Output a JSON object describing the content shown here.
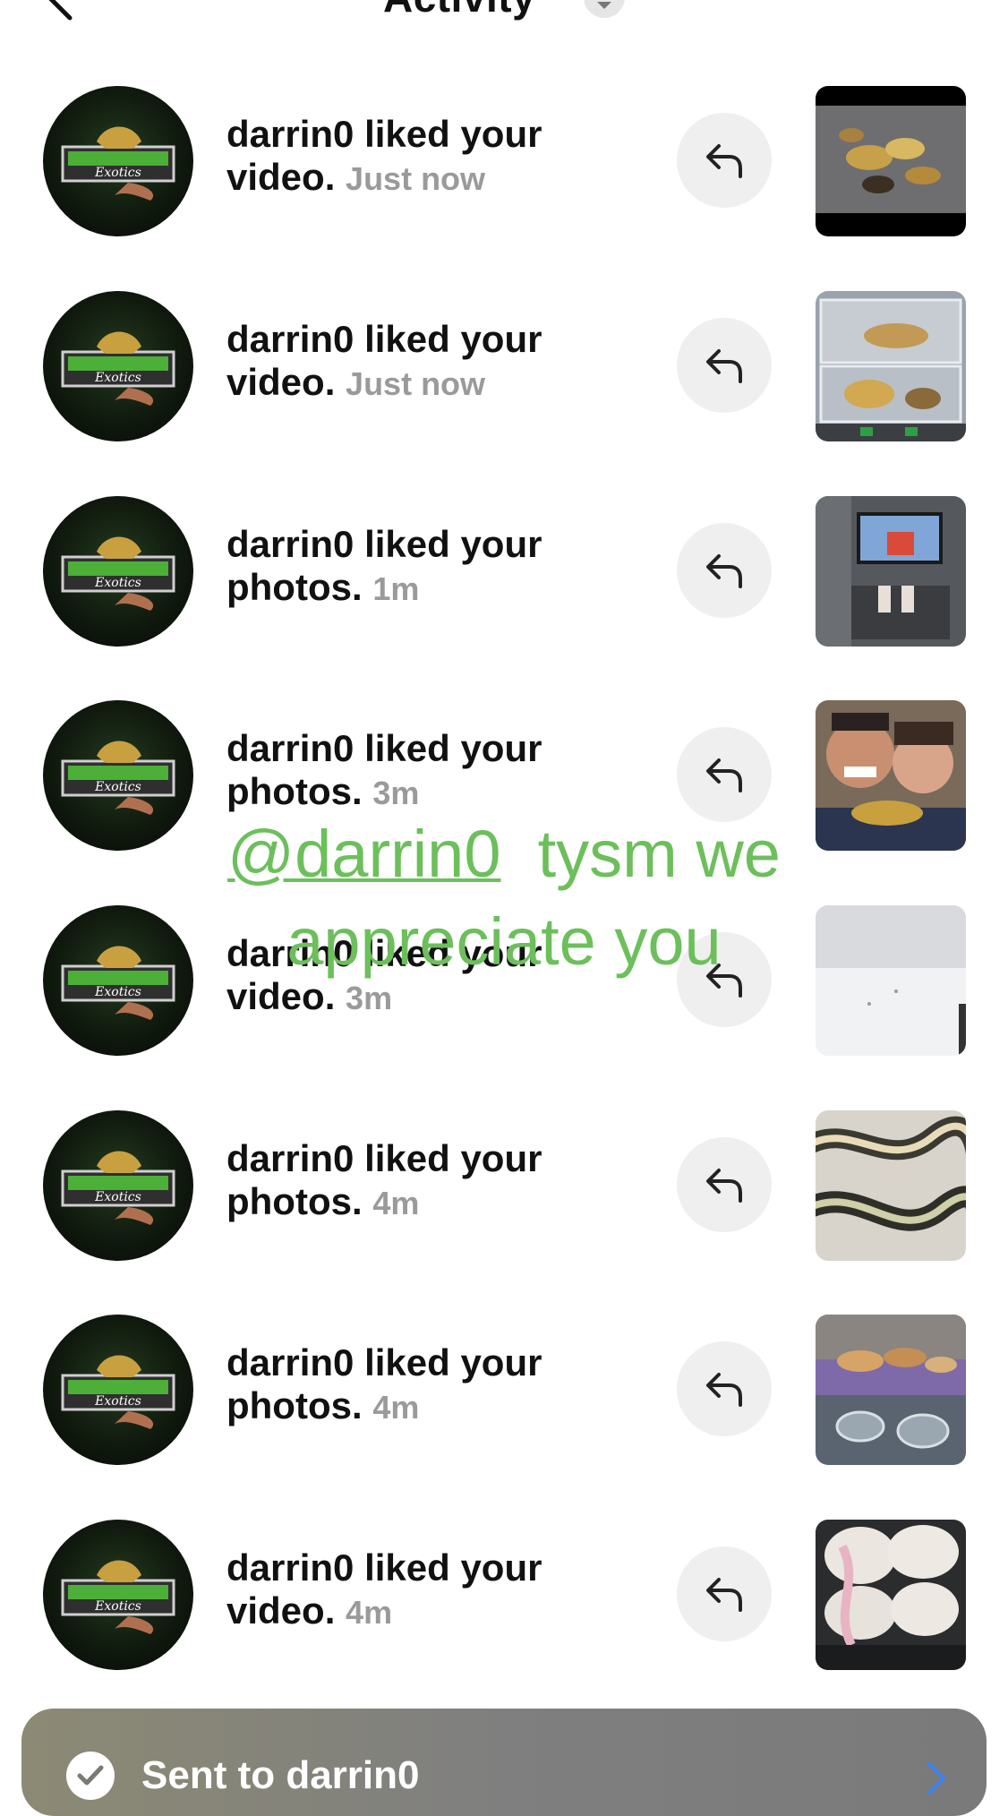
{
  "header": {
    "title": "Activity",
    "back_icon": "chevron-left-icon",
    "dropdown_icon": "chevron-down-icon"
  },
  "activity": [
    {
      "user": "darrin0",
      "action": "liked your",
      "object": "video.",
      "time": "Just now",
      "thumb": "snake-pile"
    },
    {
      "user": "darrin0",
      "action": "liked your",
      "object": "video.",
      "time": "Just now",
      "thumb": "snake-enclosure"
    },
    {
      "user": "darrin0",
      "action": "liked your",
      "object": "photos.",
      "time": "1m",
      "thumb": "tv-room"
    },
    {
      "user": "darrin0",
      "action": "liked your",
      "object": "photos.",
      "time": "3m",
      "thumb": "couple-selfie"
    },
    {
      "user": "darrin0",
      "action": "liked your",
      "object": "video.",
      "time": "3m",
      "thumb": "snow"
    },
    {
      "user": "darrin0",
      "action": "liked your",
      "object": "photos.",
      "time": "4m",
      "thumb": "snake-closeup"
    },
    {
      "user": "darrin0",
      "action": "liked your",
      "object": "photos.",
      "time": "4m",
      "thumb": "snakes-on-table"
    },
    {
      "user": "darrin0",
      "action": "liked your",
      "object": "video.",
      "time": "4m",
      "thumb": "eggs-hatching"
    }
  ],
  "sticker": {
    "mention": "@darrin0",
    "line1_rest": "tysm we",
    "line2": "appreciate you"
  },
  "banner": {
    "text": "Sent to darrin0",
    "icon": "check-circle-icon",
    "chevron_icon": "chevron-right-icon"
  },
  "colors": {
    "sticker": "#6cbf5b",
    "time_text": "#9a9a9a",
    "reply_button_bg": "#efefef",
    "banner_chevron": "#3b82f6"
  }
}
